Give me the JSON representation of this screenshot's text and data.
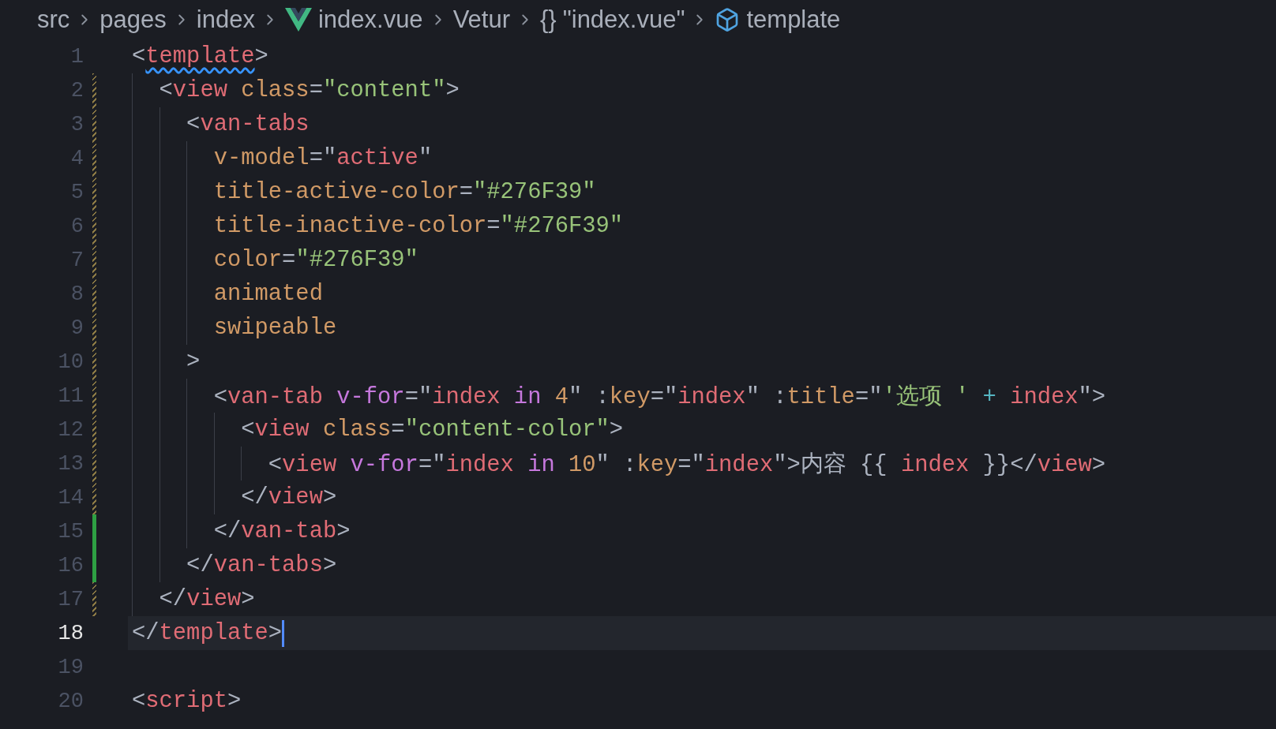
{
  "breadcrumb": [
    {
      "kind": "text",
      "label": "src"
    },
    {
      "kind": "text",
      "label": "pages"
    },
    {
      "kind": "text",
      "label": "index"
    },
    {
      "kind": "vue",
      "label": "index.vue"
    },
    {
      "kind": "text",
      "label": "Vetur"
    },
    {
      "kind": "braces",
      "glyph": "{}",
      "label": "\"index.vue\""
    },
    {
      "kind": "cube",
      "label": "template"
    }
  ],
  "lines": [
    {
      "number": "1",
      "modified": false,
      "added": false,
      "current": false,
      "tokens": [
        {
          "kind": "punct",
          "text": "<"
        },
        {
          "kind": "tag",
          "text": "template",
          "squiggle": true
        },
        {
          "kind": "punct",
          "text": ">"
        }
      ]
    },
    {
      "number": "2",
      "modified": true,
      "added": false,
      "current": false,
      "tokens": [
        {
          "kind": "punct",
          "text": "  <"
        },
        {
          "kind": "tag",
          "text": "view"
        },
        {
          "kind": "attr",
          "text": " class"
        },
        {
          "kind": "punct",
          "text": "="
        },
        {
          "kind": "string",
          "text": "\"content\""
        },
        {
          "kind": "punct",
          "text": ">"
        }
      ]
    },
    {
      "number": "3",
      "modified": true,
      "added": false,
      "current": false,
      "tokens": [
        {
          "kind": "punct",
          "text": "    <"
        },
        {
          "kind": "tag",
          "text": "van-tabs"
        }
      ]
    },
    {
      "number": "4",
      "modified": true,
      "added": false,
      "current": false,
      "tokens": [
        {
          "kind": "attr",
          "text": "      v-model"
        },
        {
          "kind": "punct",
          "text": "=\""
        },
        {
          "kind": "variable",
          "text": "active"
        },
        {
          "kind": "punct",
          "text": "\""
        }
      ]
    },
    {
      "number": "5",
      "modified": true,
      "added": false,
      "current": false,
      "tokens": [
        {
          "kind": "attr",
          "text": "      title-active-color"
        },
        {
          "kind": "punct",
          "text": "="
        },
        {
          "kind": "string",
          "text": "\"#276F39\""
        }
      ]
    },
    {
      "number": "6",
      "modified": true,
      "added": false,
      "current": false,
      "tokens": [
        {
          "kind": "attr",
          "text": "      title-inactive-color"
        },
        {
          "kind": "punct",
          "text": "="
        },
        {
          "kind": "string",
          "text": "\"#276F39\""
        }
      ]
    },
    {
      "number": "7",
      "modified": true,
      "added": false,
      "current": false,
      "tokens": [
        {
          "kind": "attr",
          "text": "      color"
        },
        {
          "kind": "punct",
          "text": "="
        },
        {
          "kind": "string",
          "text": "\"#276F39\""
        }
      ]
    },
    {
      "number": "8",
      "modified": true,
      "added": false,
      "current": false,
      "tokens": [
        {
          "kind": "attr",
          "text": "      animated"
        }
      ]
    },
    {
      "number": "9",
      "modified": true,
      "added": false,
      "current": false,
      "tokens": [
        {
          "kind": "attr",
          "text": "      swipeable"
        }
      ]
    },
    {
      "number": "10",
      "modified": true,
      "added": false,
      "current": false,
      "tokens": [
        {
          "kind": "punct",
          "text": "    >"
        }
      ]
    },
    {
      "number": "11",
      "modified": true,
      "added": false,
      "current": false,
      "tokens": [
        {
          "kind": "punct",
          "text": "      <"
        },
        {
          "kind": "tag",
          "text": "van-tab"
        },
        {
          "kind": "keyword",
          "text": " v-for"
        },
        {
          "kind": "punct",
          "text": "=\""
        },
        {
          "kind": "variable",
          "text": "index"
        },
        {
          "kind": "keyword",
          "text": " in"
        },
        {
          "kind": "number",
          "text": " 4"
        },
        {
          "kind": "punct",
          "text": "\" :"
        },
        {
          "kind": "attr",
          "text": "key"
        },
        {
          "kind": "punct",
          "text": "=\""
        },
        {
          "kind": "variable",
          "text": "index"
        },
        {
          "kind": "punct",
          "text": "\" :"
        },
        {
          "kind": "attr",
          "text": "title"
        },
        {
          "kind": "punct",
          "text": "=\""
        },
        {
          "kind": "string",
          "text": "'选项 '"
        },
        {
          "kind": "operator",
          "text": " + "
        },
        {
          "kind": "variable",
          "text": "index"
        },
        {
          "kind": "punct",
          "text": "\">"
        }
      ]
    },
    {
      "number": "12",
      "modified": true,
      "added": false,
      "current": false,
      "tokens": [
        {
          "kind": "punct",
          "text": "        <"
        },
        {
          "kind": "tag",
          "text": "view"
        },
        {
          "kind": "attr",
          "text": " class"
        },
        {
          "kind": "punct",
          "text": "="
        },
        {
          "kind": "string",
          "text": "\"content-color\""
        },
        {
          "kind": "punct",
          "text": ">"
        }
      ]
    },
    {
      "number": "13",
      "modified": true,
      "added": false,
      "current": false,
      "tokens": [
        {
          "kind": "punct",
          "text": "          <"
        },
        {
          "kind": "tag",
          "text": "view"
        },
        {
          "kind": "keyword",
          "text": " v-for"
        },
        {
          "kind": "punct",
          "text": "=\""
        },
        {
          "kind": "variable",
          "text": "index"
        },
        {
          "kind": "keyword",
          "text": " in"
        },
        {
          "kind": "number",
          "text": " 10"
        },
        {
          "kind": "punct",
          "text": "\" :"
        },
        {
          "kind": "attr",
          "text": "key"
        },
        {
          "kind": "punct",
          "text": "=\""
        },
        {
          "kind": "variable",
          "text": "index"
        },
        {
          "kind": "punct",
          "text": "\">内容 {{ "
        },
        {
          "kind": "variable",
          "text": "index"
        },
        {
          "kind": "punct",
          "text": " }}</"
        },
        {
          "kind": "tag",
          "text": "view"
        },
        {
          "kind": "punct",
          "text": ">"
        }
      ]
    },
    {
      "number": "14",
      "modified": true,
      "added": false,
      "current": false,
      "tokens": [
        {
          "kind": "punct",
          "text": "        </"
        },
        {
          "kind": "tag",
          "text": "view"
        },
        {
          "kind": "punct",
          "text": ">"
        }
      ]
    },
    {
      "number": "15",
      "modified": false,
      "added": true,
      "current": false,
      "tokens": [
        {
          "kind": "punct",
          "text": "      </"
        },
        {
          "kind": "tag",
          "text": "van-tab"
        },
        {
          "kind": "punct",
          "text": ">"
        }
      ]
    },
    {
      "number": "16",
      "modified": false,
      "added": true,
      "current": false,
      "tokens": [
        {
          "kind": "punct",
          "text": "    </"
        },
        {
          "kind": "tag",
          "text": "van-tabs"
        },
        {
          "kind": "punct",
          "text": ">"
        }
      ]
    },
    {
      "number": "17",
      "modified": true,
      "added": false,
      "current": false,
      "tokens": [
        {
          "kind": "punct",
          "text": "  </"
        },
        {
          "kind": "tag",
          "text": "view"
        },
        {
          "kind": "punct",
          "text": ">"
        }
      ]
    },
    {
      "number": "18",
      "modified": false,
      "added": false,
      "current": true,
      "tokens": [
        {
          "kind": "punct",
          "text": "</"
        },
        {
          "kind": "tag",
          "text": "template"
        },
        {
          "kind": "punct",
          "text": ">"
        }
      ]
    },
    {
      "number": "19",
      "modified": false,
      "added": false,
      "current": false
    },
    {
      "number": "20",
      "modified": false,
      "added": false,
      "current": false,
      "tokens": [
        {
          "kind": "punct",
          "text": "<"
        },
        {
          "kind": "tag",
          "text": "script"
        },
        {
          "kind": "punct",
          "text": ">"
        }
      ]
    }
  ]
}
